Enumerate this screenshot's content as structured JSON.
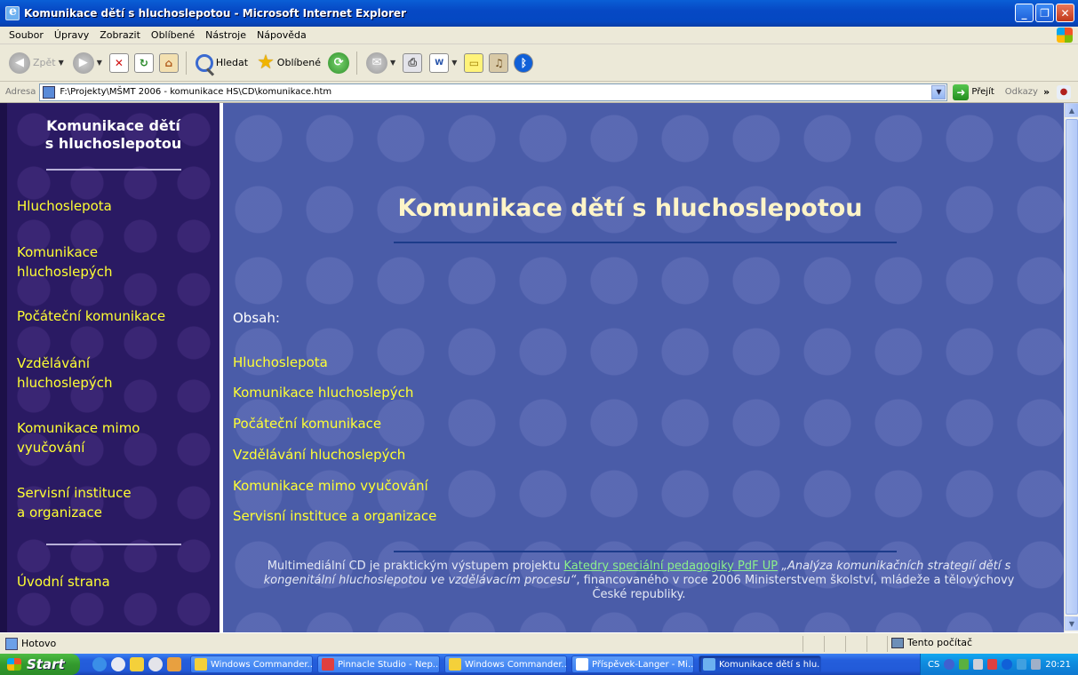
{
  "window": {
    "title": "Komunikace dětí s hluchoslepotou - Microsoft Internet Explorer",
    "controls": {
      "minimize": "_",
      "maximize": "❐",
      "close": "✕"
    }
  },
  "menu": [
    "Soubor",
    "Úpravy",
    "Zobrazit",
    "Oblíbené",
    "Nástroje",
    "Nápověda"
  ],
  "toolbar": {
    "back_label": "Zpět",
    "search_label": "Hledat",
    "favorites_label": "Oblíbené"
  },
  "address": {
    "label": "Adresa",
    "value": "F:\\Projekty\\MŠMT 2006 - komunikace HS\\CD\\komunikace.htm",
    "go_label": "Přejít",
    "links_label": "Odkazy"
  },
  "sidebar": {
    "title_line1": "Komunikace dětí",
    "title_line2": "s hluchoslepotou",
    "items": [
      {
        "line1": "Hluchoslepota",
        "line2": ""
      },
      {
        "line1": "Komunikace",
        "line2": "hluchoslepých"
      },
      {
        "line1": "Počáteční komunikace",
        "line2": ""
      },
      {
        "line1": "Vzdělávání",
        "line2": "hluchoslepých"
      },
      {
        "line1": "Komunikace mimo",
        "line2": "vyučování"
      },
      {
        "line1": "Servisní instituce",
        "line2": "a organizace"
      }
    ],
    "home": "Úvodní strana"
  },
  "main": {
    "title": "Komunikace dětí s hluchoslepotou",
    "toc_heading": "Obsah:",
    "toc": [
      "Hluchoslepota",
      "Komunikace hluchoslepých",
      "Počáteční komunikace",
      "Vzdělávání hluchoslepých",
      "Komunikace mimo vyučování",
      "Servisní instituce a organizace"
    ],
    "footer": {
      "before_link": "Multimediální CD je praktickým výstupem projektu ",
      "link": "Katedry speciální pedagogiky PdF UP",
      "italic": " „Analýza komunikačních strategií dětí s kongenitální hluchoslepotou ve vzdělávacím procesu“",
      "after": ", financovaného v roce 2006 Ministerstvem školství, mládeže a tělovýchovy České republiky."
    }
  },
  "status": {
    "text": "Hotovo",
    "zone": "Tento počítač"
  },
  "taskbar": {
    "start": "Start",
    "tasks": [
      "Windows Commander...",
      "Pinnacle Studio - Nep...",
      "Windows Commander...",
      "Příspěvek-Langer - Mi...",
      "Komunikace dětí s hlu..."
    ],
    "lang": "CS",
    "clock": "20:21"
  }
}
